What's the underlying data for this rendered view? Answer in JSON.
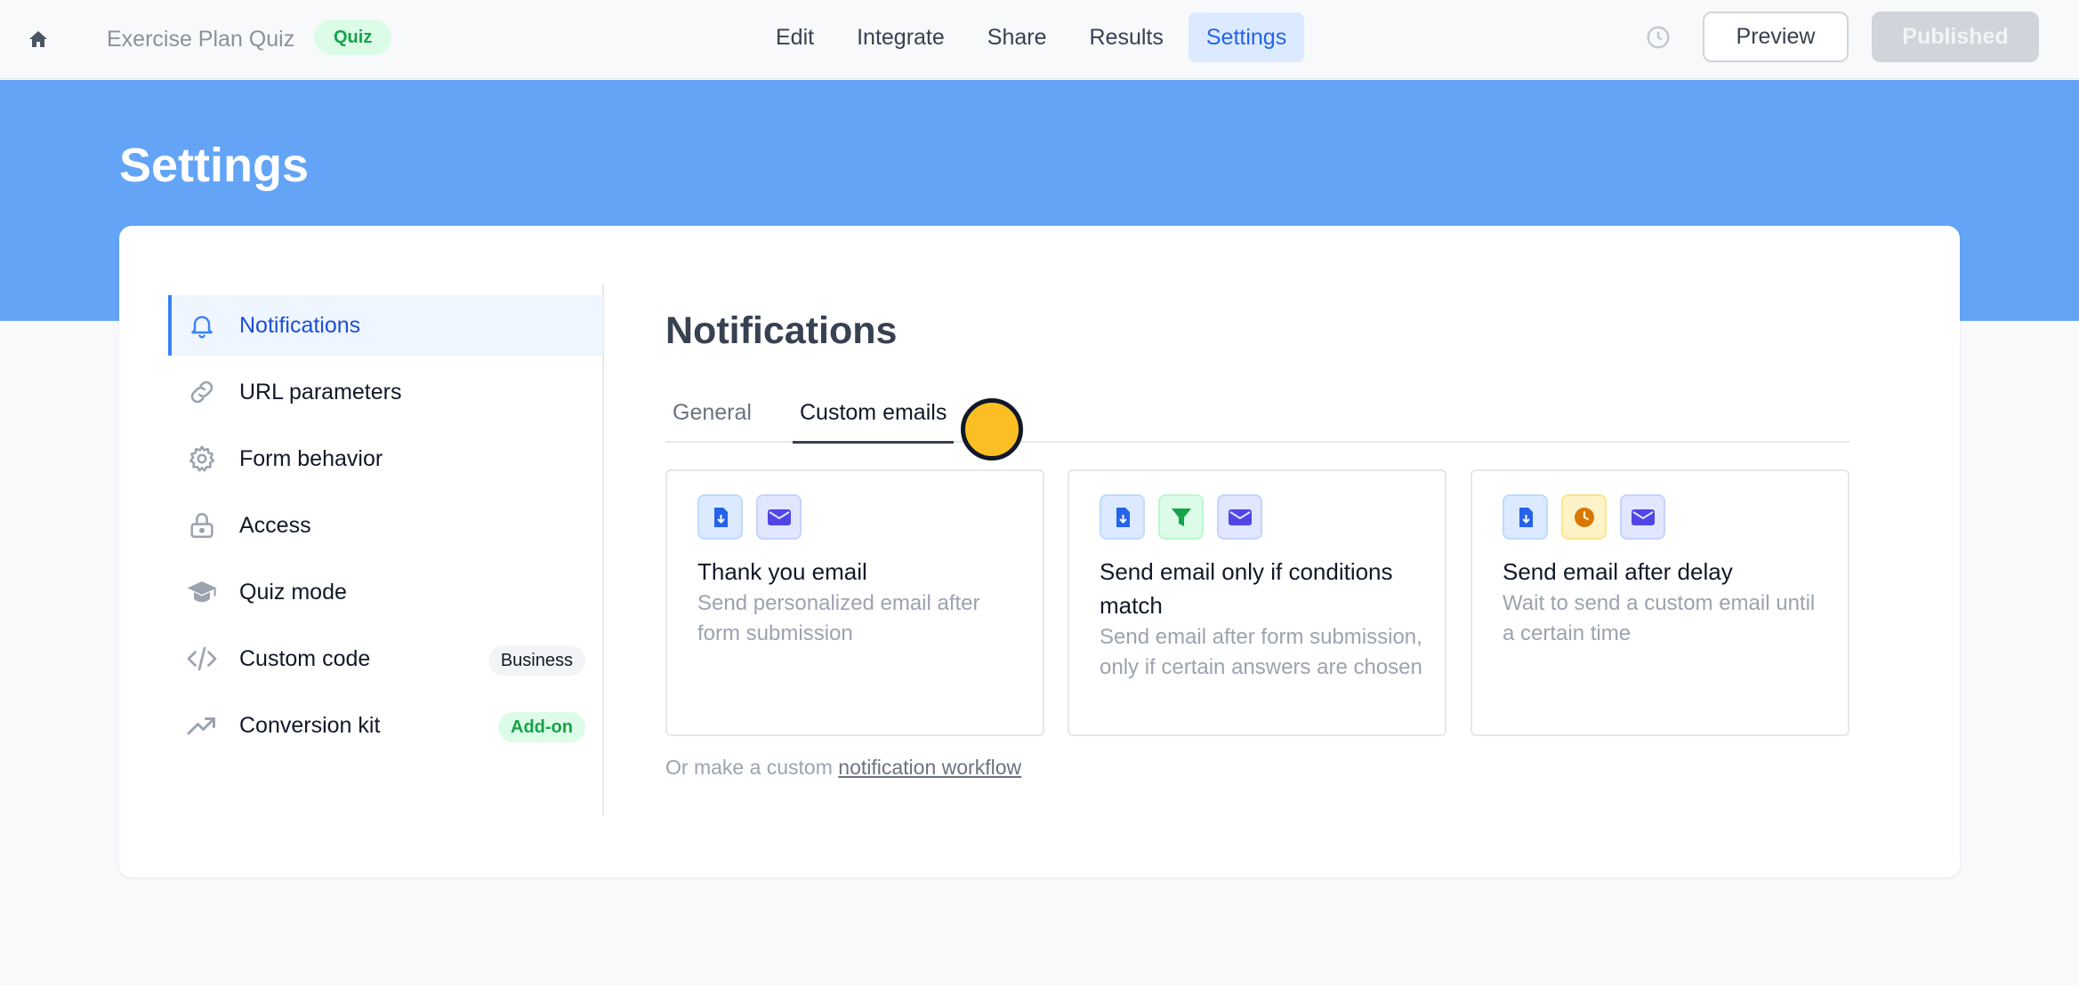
{
  "topbar": {
    "form_title": "Exercise Plan Quiz",
    "badge": "Quiz",
    "nav": [
      {
        "label": "Edit",
        "active": false
      },
      {
        "label": "Integrate",
        "active": false
      },
      {
        "label": "Share",
        "active": false
      },
      {
        "label": "Results",
        "active": false
      },
      {
        "label": "Settings",
        "active": true
      }
    ],
    "preview_label": "Preview",
    "published_label": "Published"
  },
  "hero": {
    "title": "Settings"
  },
  "sidebar": {
    "items": [
      {
        "label": "Notifications",
        "icon": "bell-icon",
        "active": true
      },
      {
        "label": "URL parameters",
        "icon": "link-icon"
      },
      {
        "label": "Form behavior",
        "icon": "gear-icon"
      },
      {
        "label": "Access",
        "icon": "lock-icon"
      },
      {
        "label": "Quiz mode",
        "icon": "graduation-cap-icon"
      },
      {
        "label": "Custom code",
        "icon": "code-icon",
        "tag": "Business"
      },
      {
        "label": "Conversion kit",
        "icon": "trending-up-icon",
        "tag": "Add-on"
      }
    ]
  },
  "main": {
    "title": "Notifications",
    "tabs": [
      {
        "label": "General",
        "active": false
      },
      {
        "label": "Custom emails",
        "active": true
      }
    ],
    "tiles": [
      {
        "title": "Thank you email",
        "description": "Send personalized email after form submission",
        "icons": [
          "form-submit-icon",
          "envelope-icon"
        ]
      },
      {
        "title": "Send email only if conditions match",
        "description": "Send email after form submission, only if certain answers are chosen",
        "icons": [
          "form-submit-icon",
          "filter-icon",
          "envelope-icon"
        ]
      },
      {
        "title": "Send email after delay",
        "description": "Wait to send a custom email until a certain time",
        "icons": [
          "form-submit-icon",
          "clock-icon",
          "envelope-icon"
        ]
      }
    ],
    "footer_prefix": "Or make a custom",
    "footer_link": "notification workflow"
  },
  "colors": {
    "accent": "#2563eb",
    "hero": "#63a4f7",
    "badge_green": "#16a34a"
  }
}
